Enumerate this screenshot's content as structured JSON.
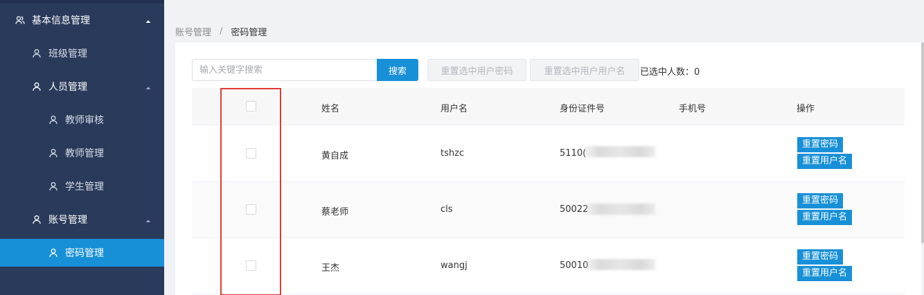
{
  "sidebar": {
    "items": [
      {
        "label": "基本信息管理",
        "icon": "users-icon",
        "level": 0,
        "expanded": true
      },
      {
        "label": "班级管理",
        "icon": "user-icon",
        "level": 1
      },
      {
        "label": "人员管理",
        "icon": "user-icon",
        "level": 1,
        "expanded": true
      },
      {
        "label": "教师审核",
        "icon": "user-icon",
        "level": 2
      },
      {
        "label": "教师管理",
        "icon": "user-icon",
        "level": 2
      },
      {
        "label": "学生管理",
        "icon": "user-icon",
        "level": 2
      },
      {
        "label": "账号管理",
        "icon": "user-icon",
        "level": 1,
        "expanded": true
      },
      {
        "label": "密码管理",
        "icon": "user-icon",
        "level": 2,
        "active": true
      }
    ]
  },
  "breadcrumb": {
    "parent": "账号管理",
    "separator": "/",
    "current": "密码管理"
  },
  "toolbar": {
    "search_placeholder": "输入关键字搜索",
    "search_value": "",
    "search_label": "搜索",
    "reset_password_label": "重置选中用户密码",
    "reset_username_label": "重置选中用户用户名",
    "selected_count_label": "已选中人数：0"
  },
  "table": {
    "headers": {
      "name": "姓名",
      "username": "用户名",
      "id_number": "身份证件号",
      "phone": "手机号",
      "actions": "操作"
    },
    "rows": [
      {
        "name": "黄自成",
        "username": "tshzc",
        "id_number": "5110(",
        "phone": "",
        "checked": false
      },
      {
        "name": "蔡老师",
        "username": "cls",
        "id_number": "50022",
        "phone": "",
        "checked": false
      },
      {
        "name": "王杰",
        "username": "wangj",
        "id_number": "50010",
        "phone": "",
        "checked": false
      }
    ],
    "row_actions": {
      "reset_password": "重置密码",
      "reset_username": "重置用户名"
    }
  },
  "colors": {
    "sidebar_bg": "#2a3a5a",
    "accent": "#1890d8",
    "highlight_border": "#e53935"
  }
}
